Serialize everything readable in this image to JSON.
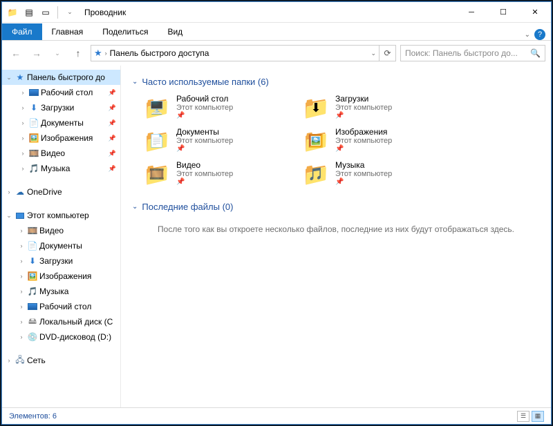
{
  "window": {
    "title": "Проводник"
  },
  "ribbon": {
    "file": "Файл",
    "tabs": [
      "Главная",
      "Поделиться",
      "Вид"
    ]
  },
  "address": {
    "path": "Панель быстрого доступа"
  },
  "search": {
    "placeholder": "Поиск: Панель быстрого до..."
  },
  "tree": {
    "quick_access": "Панель быстрого до",
    "quick_items": [
      {
        "label": "Рабочий стол",
        "icon": "desktop"
      },
      {
        "label": "Загрузки",
        "icon": "download"
      },
      {
        "label": "Документы",
        "icon": "document"
      },
      {
        "label": "Изображения",
        "icon": "picture"
      },
      {
        "label": "Видео",
        "icon": "video"
      },
      {
        "label": "Музыка",
        "icon": "music"
      }
    ],
    "onedrive": "OneDrive",
    "this_pc": "Этот компьютер",
    "pc_items": [
      {
        "label": "Видео",
        "icon": "video"
      },
      {
        "label": "Документы",
        "icon": "document"
      },
      {
        "label": "Загрузки",
        "icon": "download"
      },
      {
        "label": "Изображения",
        "icon": "picture"
      },
      {
        "label": "Музыка",
        "icon": "music"
      },
      {
        "label": "Рабочий стол",
        "icon": "desktop"
      },
      {
        "label": "Локальный диск (C",
        "icon": "disk"
      },
      {
        "label": "DVD-дисковод (D:)",
        "icon": "dvd"
      }
    ],
    "network": "Сеть"
  },
  "content": {
    "group1_label": "Часто используемые папки (6)",
    "group1_items": [
      {
        "name": "Рабочий стол",
        "sub": "Этот компьютер",
        "overlay": "🖥️"
      },
      {
        "name": "Загрузки",
        "sub": "Этот компьютер",
        "overlay": "⬇"
      },
      {
        "name": "Документы",
        "sub": "Этот компьютер",
        "overlay": "📄"
      },
      {
        "name": "Изображения",
        "sub": "Этот компьютер",
        "overlay": "🖼️"
      },
      {
        "name": "Видео",
        "sub": "Этот компьютер",
        "overlay": "🎞️"
      },
      {
        "name": "Музыка",
        "sub": "Этот компьютер",
        "overlay": "🎵"
      }
    ],
    "group2_label": "Последние файлы (0)",
    "group2_empty": "После того как вы откроете несколько файлов, последние из них будут отображаться здесь."
  },
  "status": {
    "count_label": "Элементов: 6"
  }
}
